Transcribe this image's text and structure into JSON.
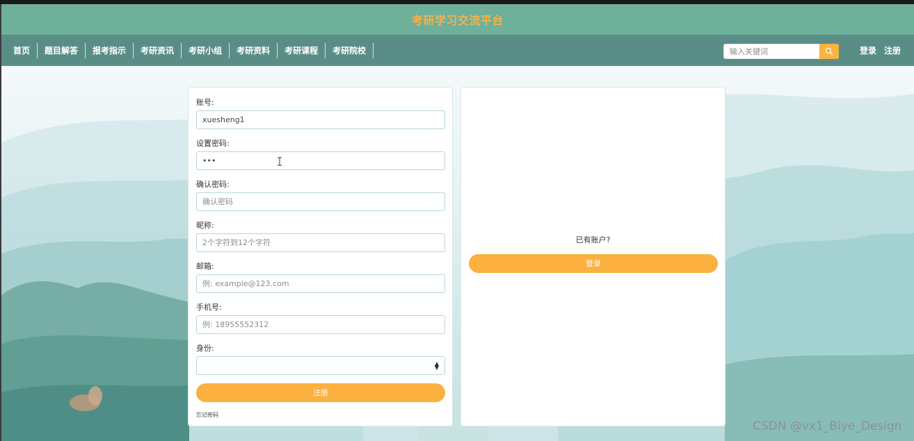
{
  "site": {
    "title": "考研学习交流平台"
  },
  "nav": {
    "items": [
      "首页",
      "题目解答",
      "报考指示",
      "考研资讯",
      "考研小组",
      "考研资料",
      "考研课程",
      "考研院校"
    ],
    "search_placeholder": "输入关键词",
    "login": "登录",
    "register": "注册"
  },
  "register_form": {
    "account": {
      "label": "账号:",
      "value": "xuesheng1"
    },
    "password": {
      "label": "设置密码:",
      "value": "•••"
    },
    "confirm": {
      "label": "确认密码:",
      "placeholder": "确认密码"
    },
    "nickname": {
      "label": "昵称:",
      "placeholder": "2个字符到12个字符"
    },
    "email": {
      "label": "邮箱:",
      "placeholder": "例: example@123.com"
    },
    "phone": {
      "label": "手机号:",
      "placeholder": "例: 18955552312"
    },
    "identity": {
      "label": "身份:",
      "value": ""
    },
    "submit": "注册",
    "forgot": "忘记密码"
  },
  "login_panel": {
    "prompt": "已有账户?",
    "button": "登录"
  },
  "watermark": "CSDN @vx1_Biye_Design",
  "colors": {
    "title_bar": "#6fb09b",
    "title_text": "#f7b24b",
    "nav_bar": "#5b8d87",
    "accent": "#fbb040"
  },
  "icons": {
    "search": "search-icon",
    "select": "select-arrows-icon",
    "cursor": "text-cursor-icon"
  }
}
